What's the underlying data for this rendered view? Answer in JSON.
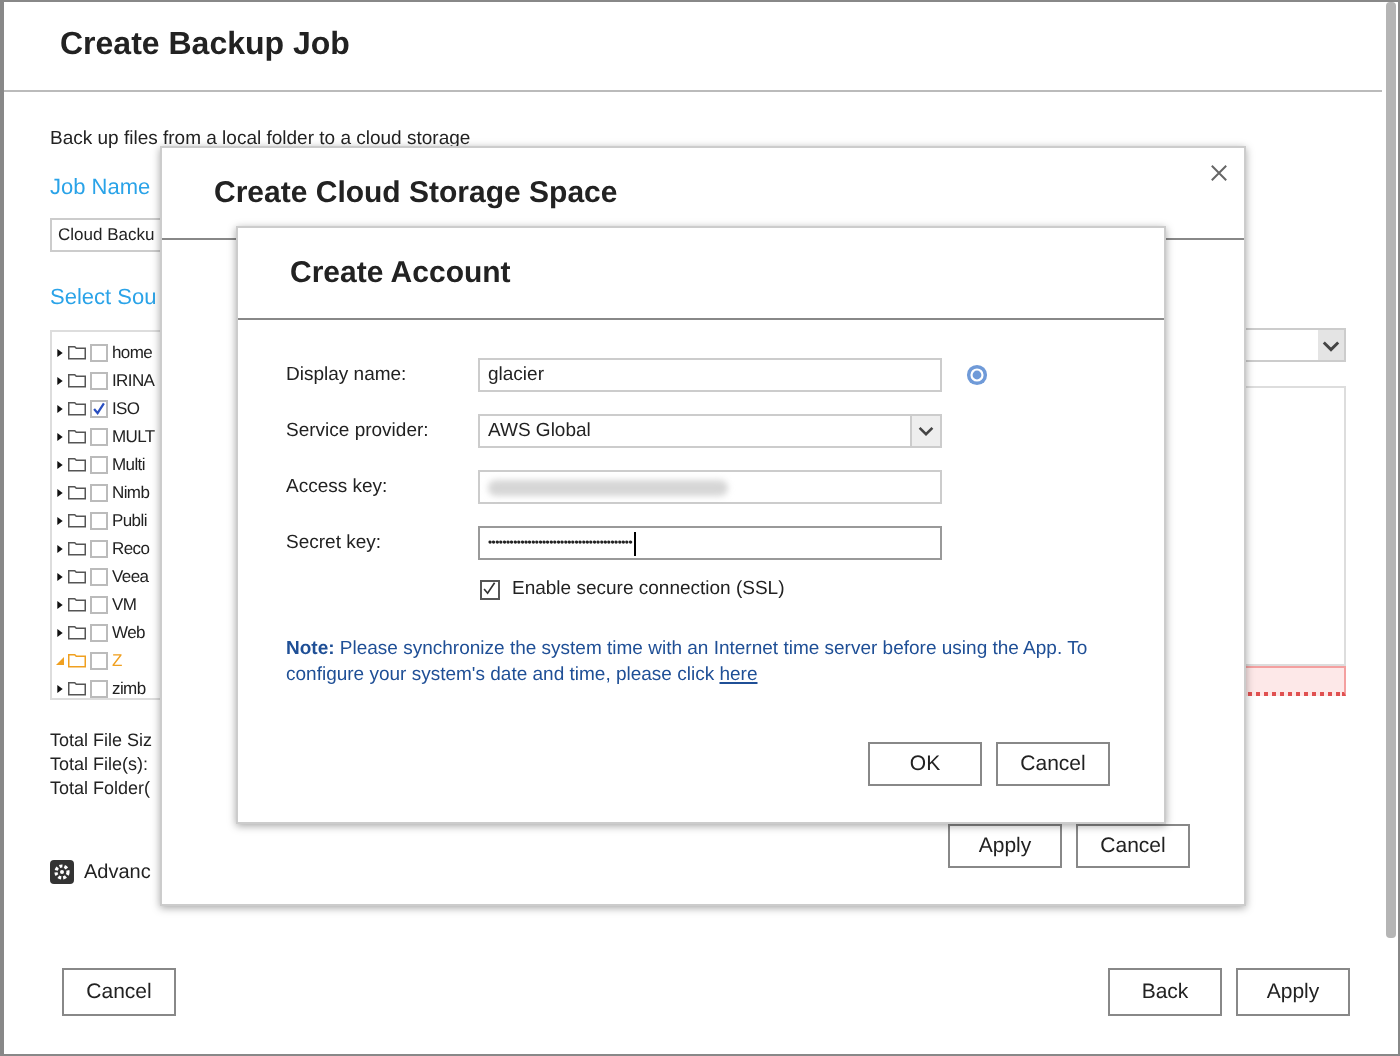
{
  "window": {
    "title": "Create Backup Job",
    "description": "Back up files from a local folder to a cloud storage",
    "job_name_label": "Job Name",
    "job_name_value": "Cloud Backu",
    "source_label": "Select Sou",
    "folders": [
      {
        "name": "home",
        "checked": false,
        "expanded": false,
        "selected": false
      },
      {
        "name": "IRINA",
        "checked": false,
        "expanded": false,
        "selected": false
      },
      {
        "name": "ISO",
        "checked": true,
        "expanded": false,
        "selected": false
      },
      {
        "name": "MULT",
        "checked": false,
        "expanded": false,
        "selected": false
      },
      {
        "name": "Multi",
        "checked": false,
        "expanded": false,
        "selected": false
      },
      {
        "name": "Nimb",
        "checked": false,
        "expanded": false,
        "selected": false
      },
      {
        "name": "Publi",
        "checked": false,
        "expanded": false,
        "selected": false
      },
      {
        "name": "Reco",
        "checked": false,
        "expanded": false,
        "selected": false
      },
      {
        "name": "Veea",
        "checked": false,
        "expanded": false,
        "selected": false
      },
      {
        "name": "VM",
        "checked": false,
        "expanded": false,
        "selected": false
      },
      {
        "name": "Web",
        "checked": false,
        "expanded": false,
        "selected": false
      },
      {
        "name": "Z",
        "checked": false,
        "expanded": true,
        "selected": true
      },
      {
        "name": "zimb",
        "checked": false,
        "expanded": false,
        "selected": false
      }
    ],
    "totals": [
      "Total File Siz",
      "Total File(s):",
      "Total Folder("
    ],
    "advanced": "Advanc",
    "buttons": {
      "cancel": "Cancel",
      "back": "Back",
      "apply": "Apply"
    }
  },
  "storage_dialog": {
    "title": "Create Cloud Storage Space",
    "buttons": [
      "Apply",
      "Cancel"
    ]
  },
  "account_dialog": {
    "title": "Create Account",
    "fields": [
      {
        "label": "Display name:",
        "kind": "text",
        "value": "glacier"
      },
      {
        "label": "Service provider:",
        "kind": "select",
        "value": "AWS Global"
      },
      {
        "label": "Access key:",
        "kind": "blurred"
      },
      {
        "label": "Secret key:",
        "kind": "password",
        "value": "••••••••••••••••••••••••••••••••••••••••"
      }
    ],
    "ssl": {
      "label": "Enable secure connection (SSL)",
      "checked": true
    },
    "note": "**Note:** Please synchronize the system time with an Internet time server before using the App. To configure your system's date and time, please click",
    "note_link": "here",
    "buttons": [
      "OK",
      "Cancel"
    ]
  }
}
